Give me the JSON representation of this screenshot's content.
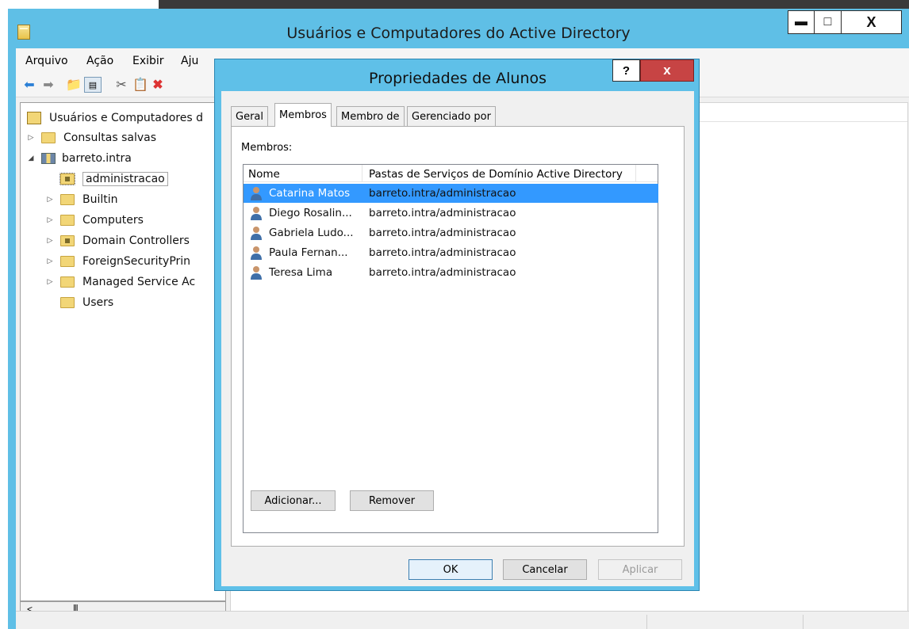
{
  "top_strip_text": "",
  "main_window": {
    "title": "Usuários e Computadores do Active Directory",
    "min_glyph": "▬",
    "max_glyph": "□",
    "close_glyph": "X"
  },
  "menu": {
    "file": "Arquivo",
    "action": "Ação",
    "view": "Exibir",
    "help": "Aju"
  },
  "tree": {
    "root": "Usuários e Computadores d",
    "items": [
      {
        "label": "Consultas salvas"
      },
      {
        "label": "barreto.intra"
      },
      {
        "label": "administracao"
      },
      {
        "label": "Builtin"
      },
      {
        "label": "Computers"
      },
      {
        "label": "Domain Controllers"
      },
      {
        "label": "ForeignSecurityPrin"
      },
      {
        "label": "Managed Service Ac"
      },
      {
        "label": "Users"
      }
    ]
  },
  "dialog": {
    "title": "Propriedades de Alunos",
    "help_glyph": "?",
    "close_glyph": "x",
    "tabs": [
      "Geral",
      "Membros",
      "Membro de",
      "Gerenciado por"
    ],
    "active_tab": "Membros",
    "members_label": "Membros:",
    "columns": [
      "Nome",
      "Pastas de Serviços de Domínio Active Directory"
    ],
    "rows": [
      {
        "name": "Catarina Matos",
        "path": "barreto.intra/administracao",
        "selected": true
      },
      {
        "name": "Diego Rosalin...",
        "path": "barreto.intra/administracao"
      },
      {
        "name": "Gabriela Ludo...",
        "path": "barreto.intra/administracao"
      },
      {
        "name": "Paula Fernan...",
        "path": "barreto.intra/administracao"
      },
      {
        "name": "Teresa Lima",
        "path": "barreto.intra/administracao"
      }
    ],
    "buttons": {
      "add": "Adicionar...",
      "remove": "Remover",
      "ok": "OK",
      "cancel": "Cancelar",
      "apply": "Aplicar"
    }
  },
  "colors": {
    "chrome": "#5fbfe6",
    "selection": "#3399ff",
    "close": "#c74444"
  }
}
